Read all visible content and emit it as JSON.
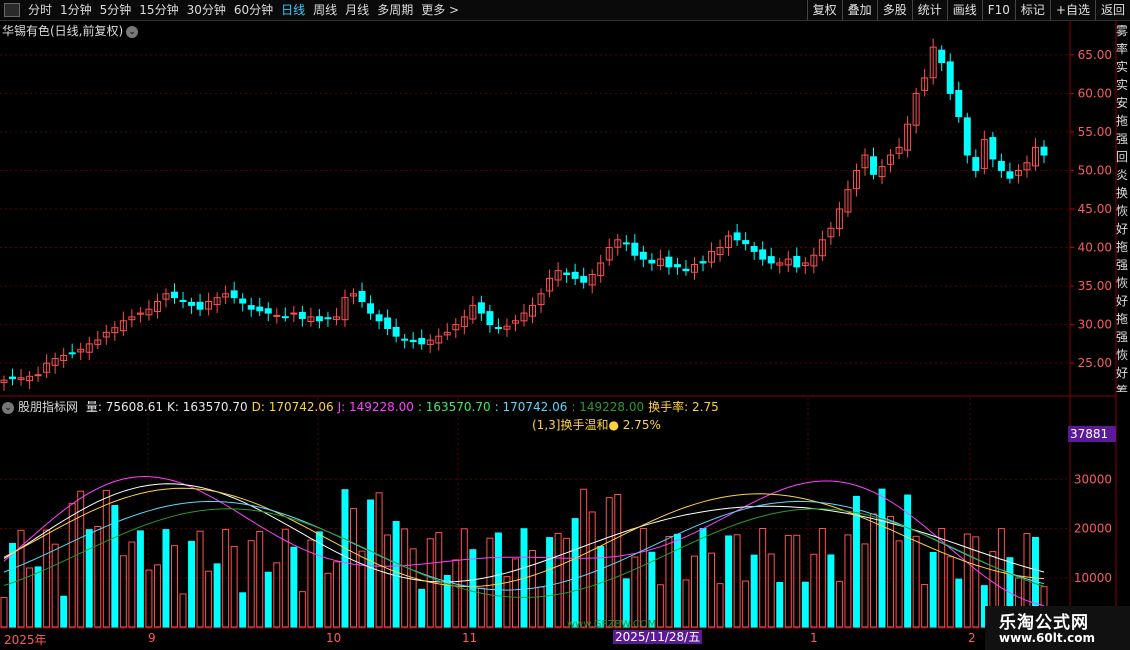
{
  "toolbar": {
    "periods": [
      "分时",
      "1分钟",
      "5分钟",
      "15分钟",
      "30分钟",
      "60分钟",
      "日线",
      "周线",
      "月线",
      "多周期",
      "更多 >"
    ],
    "active_period": "日线",
    "right_buttons": [
      "复权",
      "叠加",
      "多股",
      "统计",
      "画线",
      "F10",
      "标记",
      "+自选",
      "返回"
    ]
  },
  "stock": {
    "title": "华锡有色(日线,前复权)"
  },
  "price_axis": {
    "labels": [
      "65.00",
      "60.00",
      "55.00",
      "50.00",
      "45.00",
      "40.00",
      "35.00",
      "30.00",
      "25.00"
    ],
    "min": 21,
    "max": 69
  },
  "indicator": {
    "name": "股朋指标网",
    "values": [
      {
        "text": "量: 75608.61",
        "color": "#e8e8e8"
      },
      {
        "text": "K: 163570.70",
        "color": "#e8e8e8"
      },
      {
        "text": "D: 170742.06",
        "color": "#ffd23f"
      },
      {
        "text": "J: 149228.00",
        "color": "#ff40ff"
      },
      {
        "text": ": 163570.70",
        "color": "#33ee66"
      },
      {
        "text": ": 170742.06",
        "color": "#5ad7ff"
      },
      {
        "text": ": 149228.00",
        "color": "#2a9a2a"
      },
      {
        "text": "换手率: 2.75",
        "color": "#ffd23f"
      }
    ],
    "turnover_note": "(1,3]换手温和● 2.75%"
  },
  "volume_axis": {
    "labels": [
      "30000",
      "20000",
      "10000"
    ],
    "tag": "37881"
  },
  "x_axis": {
    "labels": [
      "2025年",
      "9",
      "10",
      "11",
      "1",
      "2"
    ],
    "date_label": "2025/11/28/五"
  },
  "right_tags": [
    "雾",
    "率",
    "实",
    "实",
    "安",
    "拖",
    "强",
    "回",
    "炎",
    "换",
    "恢",
    "好",
    "拖",
    "强",
    "恢",
    "好",
    "拖",
    "强",
    "恢",
    "好",
    "筹"
  ],
  "watermark": "www.GPZBW.COM",
  "logo": {
    "line1": "乐淘公式网",
    "line2": "www.60lt.com"
  },
  "colors": {
    "up": "#ff5050",
    "down": "#00ffff",
    "grid": "#5a0000"
  }
}
